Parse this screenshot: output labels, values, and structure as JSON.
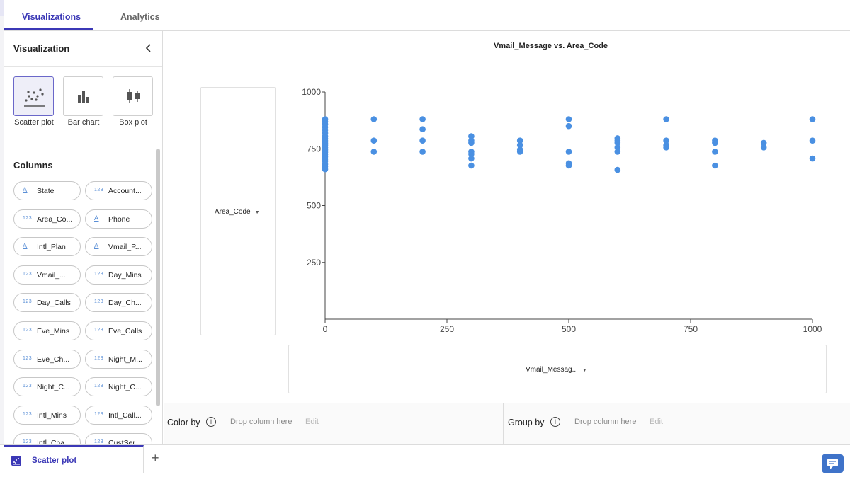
{
  "tabs": [
    {
      "label": "Visualizations",
      "active": true
    },
    {
      "label": "Analytics",
      "active": false
    }
  ],
  "sidebar": {
    "title": "Visualization",
    "collapse_icon": "chevron-left-icon",
    "viz_types": [
      {
        "label": "Scatter plot",
        "icon": "scatter-plot-icon",
        "selected": true
      },
      {
        "label": "Bar chart",
        "icon": "bar-chart-icon",
        "selected": false
      },
      {
        "label": "Box plot",
        "icon": "box-plot-icon",
        "selected": false
      }
    ],
    "columns_title": "Columns",
    "columns": [
      {
        "type": "A",
        "name": "State"
      },
      {
        "type": "123",
        "name": "Account..."
      },
      {
        "type": "123",
        "name": "Area_Co..."
      },
      {
        "type": "A",
        "name": "Phone"
      },
      {
        "type": "A",
        "name": "Intl_Plan"
      },
      {
        "type": "A",
        "name": "Vmail_P..."
      },
      {
        "type": "123",
        "name": "Vmail_..."
      },
      {
        "type": "123",
        "name": "Day_Mins"
      },
      {
        "type": "123",
        "name": "Day_Calls"
      },
      {
        "type": "123",
        "name": "Day_Ch..."
      },
      {
        "type": "123",
        "name": "Eve_Mins"
      },
      {
        "type": "123",
        "name": "Eve_Calls"
      },
      {
        "type": "123",
        "name": "Eve_Ch..."
      },
      {
        "type": "123",
        "name": "Night_M..."
      },
      {
        "type": "123",
        "name": "Night_C..."
      },
      {
        "type": "123",
        "name": "Night_C..."
      },
      {
        "type": "123",
        "name": "Intl_Mins"
      },
      {
        "type": "123",
        "name": "Intl_Call..."
      },
      {
        "type": "123",
        "name": "Intl_Cha..."
      },
      {
        "type": "123",
        "name": "CustSer..."
      }
    ]
  },
  "chart": {
    "y_column": "Area_Code",
    "x_column": "Vmail_Messag...",
    "colors": {
      "point": "#4a90e2",
      "accent": "#3b38b6"
    }
  },
  "chart_data": {
    "type": "scatter",
    "title": "Vmail_Message vs. Area_Code",
    "xlabel": "",
    "ylabel": "",
    "xlim": [
      0,
      1000
    ],
    "ylim": [
      0,
      1000
    ],
    "x_ticks": [
      "0",
      "250",
      "500",
      "750",
      "1000"
    ],
    "y_ticks": [
      "250",
      "500",
      "750",
      "1000"
    ],
    "grid": false,
    "series": [
      {
        "color": "#4a90e2",
        "points": [
          [
            0,
            880
          ],
          [
            0,
            870
          ],
          [
            0,
            858
          ],
          [
            0,
            845
          ],
          [
            0,
            832
          ],
          [
            0,
            818
          ],
          [
            0,
            805
          ],
          [
            0,
            795
          ],
          [
            0,
            785
          ],
          [
            0,
            775
          ],
          [
            0,
            765
          ],
          [
            0,
            755
          ],
          [
            0,
            745
          ],
          [
            0,
            735
          ],
          [
            0,
            725
          ],
          [
            0,
            715
          ],
          [
            0,
            705
          ],
          [
            0,
            695
          ],
          [
            0,
            682
          ],
          [
            0,
            672
          ],
          [
            0,
            660
          ],
          [
            100,
            880
          ],
          [
            100,
            786
          ],
          [
            100,
            737
          ],
          [
            200,
            880
          ],
          [
            200,
            836
          ],
          [
            200,
            786
          ],
          [
            200,
            737
          ],
          [
            300,
            805
          ],
          [
            300,
            786
          ],
          [
            300,
            776
          ],
          [
            300,
            737
          ],
          [
            300,
            727
          ],
          [
            300,
            707
          ],
          [
            300,
            676
          ],
          [
            400,
            786
          ],
          [
            400,
            766
          ],
          [
            400,
            746
          ],
          [
            400,
            737
          ],
          [
            500,
            880
          ],
          [
            500,
            850
          ],
          [
            500,
            737
          ],
          [
            500,
            686
          ],
          [
            500,
            676
          ],
          [
            600,
            796
          ],
          [
            600,
            786
          ],
          [
            600,
            776
          ],
          [
            600,
            756
          ],
          [
            600,
            737
          ],
          [
            600,
            657
          ],
          [
            700,
            880
          ],
          [
            700,
            786
          ],
          [
            700,
            766
          ],
          [
            700,
            756
          ],
          [
            800,
            786
          ],
          [
            800,
            776
          ],
          [
            800,
            737
          ],
          [
            800,
            676
          ],
          [
            900,
            776
          ],
          [
            900,
            756
          ],
          [
            1000,
            880
          ],
          [
            1000,
            786
          ],
          [
            1000,
            707
          ]
        ]
      }
    ]
  },
  "drop_zones": {
    "color_by": {
      "label": "Color by",
      "placeholder": "Drop column here",
      "edit": "Edit"
    },
    "group_by": {
      "label": "Group by",
      "placeholder": "Drop column here",
      "edit": "Edit"
    }
  },
  "footer": {
    "sheet_label": "Scatter plot",
    "sheet_icon": "scatter-plot-icon",
    "add_label": "+",
    "feedback_icon": "chat-icon"
  }
}
